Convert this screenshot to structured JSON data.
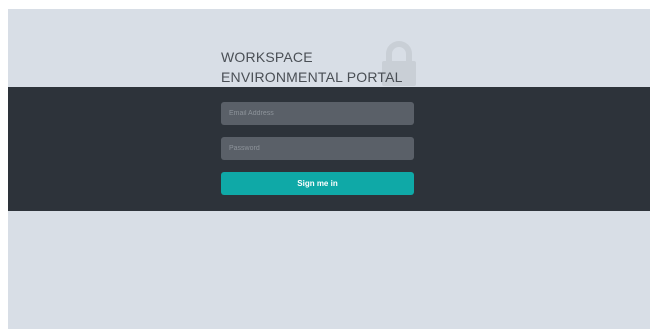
{
  "login": {
    "title_line1": "WORKSPACE",
    "title_line2": "ENVIRONMENTAL PORTAL",
    "email_placeholder": "Email Address",
    "email_value": "",
    "password_placeholder": "Password",
    "password_value": "",
    "submit_label": "Sign me in"
  },
  "icons": {
    "lock": "lock-icon"
  },
  "colors": {
    "background": "#d8dee6",
    "band": "#2d333a",
    "field": "#5a6068",
    "accent": "#0fa9a7",
    "title_text": "#4a4f55",
    "lock": "#c9cfd6"
  }
}
